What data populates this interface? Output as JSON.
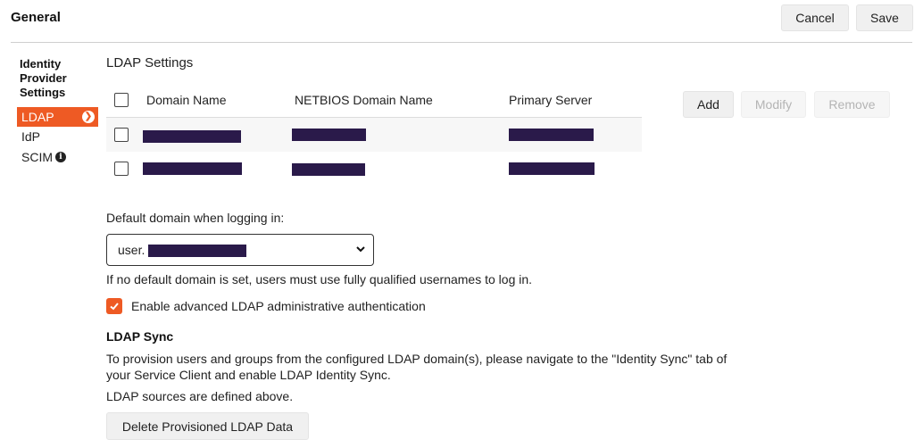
{
  "header": {
    "title": "General",
    "cancel_label": "Cancel",
    "save_label": "Save"
  },
  "sidebar": {
    "heading": "Identity Provider Settings",
    "items": [
      {
        "label": "LDAP",
        "active": true
      },
      {
        "label": "IdP",
        "active": false
      },
      {
        "label": "SCIM",
        "active": false
      }
    ]
  },
  "ldap": {
    "section_title": "LDAP Settings",
    "columns": [
      "Domain Name",
      "NETBIOS Domain Name",
      "Primary Server"
    ],
    "rows": [
      {
        "domain_name": "[redacted]",
        "netbios": "[redacted]",
        "primary_server": "[redacted]"
      },
      {
        "domain_name": "[redacted]",
        "netbios": "[redacted]",
        "primary_server": "[redacted]"
      }
    ],
    "actions": {
      "add": "Add",
      "modify": "Modify",
      "remove": "Remove"
    }
  },
  "default_domain": {
    "label": "Default domain when logging in:",
    "selected_value": "user.",
    "hint": "If no default domain is set, users must use fully qualified usernames to log in."
  },
  "advanced_auth": {
    "label": "Enable advanced LDAP administrative authentication",
    "checked": true
  },
  "ldap_sync": {
    "title": "LDAP Sync",
    "description_line1": "To provision users and groups from the configured LDAP domain(s), please navigate to the \"Identity Sync\" tab of",
    "description_line2": "your Service Client and enable LDAP Identity Sync.",
    "note": "LDAP sources are defined above.",
    "delete_button": "Delete Provisioned LDAP Data"
  },
  "colors": {
    "accent": "#ee5a24",
    "redaction": "#2a1a4a"
  }
}
